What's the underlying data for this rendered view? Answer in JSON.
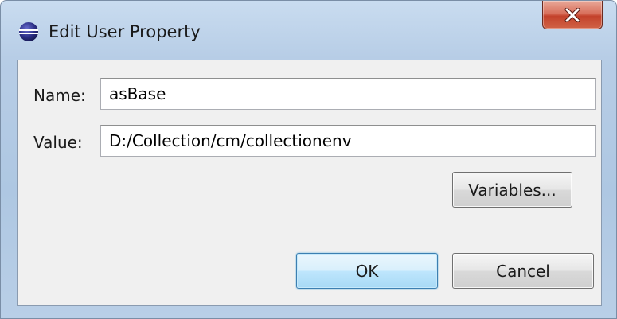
{
  "window": {
    "title": "Edit User Property",
    "app_icon": "eclipse-icon",
    "close_icon": "close-icon"
  },
  "form": {
    "name_label": "Name:",
    "name_value": "asBase",
    "value_label": "Value:",
    "value_value": "D:/Collection/cm/collectionenv"
  },
  "buttons": {
    "variables_label": "Variables...",
    "ok_label": "OK",
    "cancel_label": "Cancel"
  },
  "colors": {
    "window_frame": "#b7cde6",
    "client_bg": "#f0f0f0",
    "close_button": "#c3422b",
    "default_button": "#a7d9f5"
  }
}
